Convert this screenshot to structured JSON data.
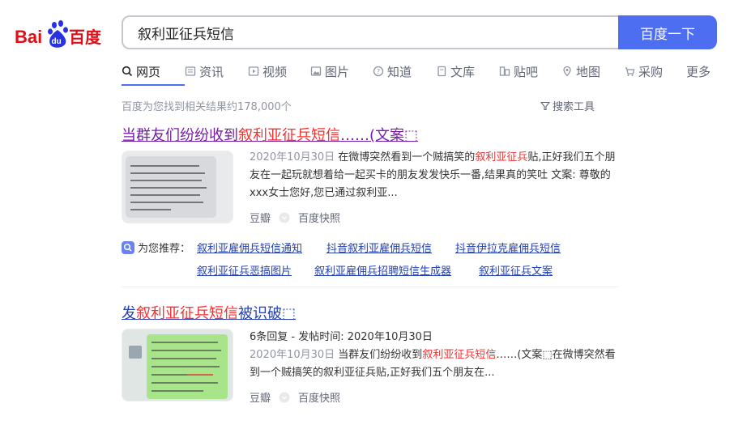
{
  "search": {
    "query": "叙利亚征兵短信",
    "button_label": "百度一下"
  },
  "tabs": [
    {
      "label": "网页",
      "icon": "search-icon"
    },
    {
      "label": "资讯",
      "icon": "news-icon"
    },
    {
      "label": "视频",
      "icon": "video-icon"
    },
    {
      "label": "图片",
      "icon": "image-icon"
    },
    {
      "label": "知道",
      "icon": "question-icon"
    },
    {
      "label": "文库",
      "icon": "document-icon"
    },
    {
      "label": "贴吧",
      "icon": "tieba-icon"
    },
    {
      "label": "地图",
      "icon": "map-icon"
    },
    {
      "label": "采购",
      "icon": "cart-icon"
    },
    {
      "label": "更多"
    }
  ],
  "result_count": "百度为您找到相关结果约178,000个",
  "tools_label": "搜索工具",
  "results": [
    {
      "title_pre": "当群友们纷纷收到",
      "title_hl": "叙利亚征兵短信",
      "title_post": "……(文案⬚",
      "date": "2020年10月30日",
      "snippet_a": " 在微博突然看到一个贼搞笑的",
      "snippet_hl": "叙利亚征兵",
      "snippet_b": "贴,正好我们五个朋友在一起玩就想着给一起买卡的朋友发发快乐一番,结果真的笑吐 文案: 尊敬的xxx女士您好,您已通过叙利亚...",
      "source": "豆瓣",
      "cache": "百度快照"
    },
    {
      "title_pre": "发",
      "title_hl": "叙利亚征兵短信",
      "title_post": "被识破⬚",
      "meta": "6条回复 - 发帖时间: 2020年10月30日",
      "date": "2020年10月30日",
      "snippet_a": " 当群友们纷纷收到",
      "snippet_hl": "叙利亚征兵短信",
      "snippet_b": "……(文案⬚在微博突然看到一个贼搞笑的叙利亚征兵贴,正好我们五个朋友在...",
      "source": "豆瓣",
      "cache": "百度快照"
    }
  ],
  "recommend": {
    "label": "为您推荐：",
    "links": [
      "叙利亚雇佣兵短信通知",
      "抖音叙利亚雇佣兵短信",
      "抖音伊拉克雇佣兵短信",
      "叙利亚征兵恶搞图片",
      "叙利亚雇佣兵招聘短信生成器",
      "叙利亚征兵文案"
    ]
  },
  "colors": {
    "brand_blue": "#4e6ef2",
    "link": "#2440b3",
    "visited": "#771caa",
    "highlight": "#f73131",
    "baidu_red": "#de0f17"
  }
}
